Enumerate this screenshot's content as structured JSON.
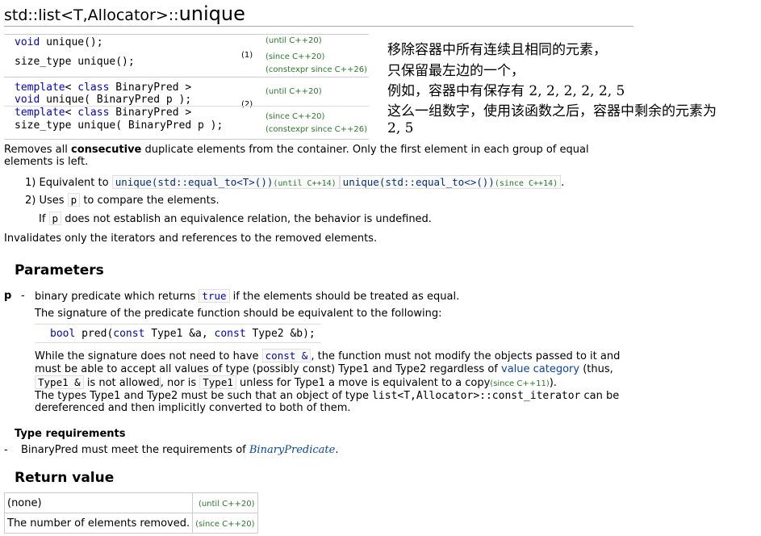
{
  "title": {
    "prefix": "std::list<T,Allocator>::",
    "name": "unique"
  },
  "declarations": [
    {
      "num": "(1)",
      "lines": [
        {
          "parts": [
            {
              "t": "void",
              "c": "kw"
            },
            {
              "t": " unique();",
              "c": "cls"
            }
          ],
          "ver": "(until C++20)"
        },
        {
          "parts": [
            {
              "t": "size_type unique();",
              "c": "cls"
            }
          ],
          "ver": "(since C++20)"
        },
        {
          "parts": [],
          "ver": "(constexpr since C++26)"
        }
      ]
    },
    {
      "num": "(2)",
      "lines": [
        {
          "parts": [
            {
              "t": "template",
              "c": "kw"
            },
            {
              "t": "< ",
              "c": "cls"
            },
            {
              "t": "class",
              "c": "kw"
            },
            {
              "t": " BinaryPred >",
              "c": "cls"
            }
          ],
          "ver": "(until C++20)"
        },
        {
          "parts": [
            {
              "t": "void",
              "c": "kw"
            },
            {
              "t": " unique( BinaryPred p );",
              "c": "cls"
            }
          ],
          "ver": ""
        },
        {
          "parts": [
            {
              "t": "template",
              "c": "kw"
            },
            {
              "t": "< ",
              "c": "cls"
            },
            {
              "t": "class",
              "c": "kw"
            },
            {
              "t": " BinaryPred >",
              "c": "cls"
            }
          ],
          "ver": "(since C++20)"
        },
        {
          "parts": [
            {
              "t": "size_type unique( BinaryPred p );",
              "c": "cls"
            }
          ],
          "ver": "(constexpr since C++26)"
        }
      ]
    }
  ],
  "annotation_cn": [
    "移除容器中所有连续且相同的元素，",
    "只保留最左边的一个，",
    "例如，容器中有保存有 2, 2, 2, 2, 2, 5",
    "这么一组数字，使用该函数之后，容器中剩余的元素为",
    "2, 5"
  ],
  "desc": {
    "removes_a": "Removes all ",
    "removes_b": "consecutive",
    "removes_c": " duplicate elements from the container. Only the first element in each group of equal elements is left.",
    "item1_a": "1) Equivalent to ",
    "item1_code1": "unique(std::equal_to<T>())",
    "item1_ver1": "(until C++14)",
    "item1_code2": "unique(std::equal_to<>())",
    "item1_ver2": "(since C++14)",
    "item2_a": "2) Uses ",
    "item2_code": "p",
    "item2_b": " to compare the elements.",
    "item2_c_a": "If ",
    "item2_c_code": "p",
    "item2_c_b": " does not establish an equivalence relation, the behavior is undefined.",
    "invalidates": "Invalidates only the iterators and references to the removed elements."
  },
  "parameters": {
    "heading": "Parameters",
    "name": "p",
    "dash": "-",
    "desc_a": "binary predicate which returns ",
    "desc_code": "true",
    "desc_b": " if the elements should be treated as equal.",
    "sig_intro": "The signature of the predicate function should be equivalent to the following:",
    "sig_code": "bool pred(const Type1 &a, const Type2 &b);",
    "while_a": "While the signature does not need to have ",
    "while_code1": "const &",
    "while_b": ", the function must not modify the objects passed to it and must be able to accept all values of type (possibly const) Type1 and Type2 regardless of ",
    "while_link": "value category",
    "while_c": " (thus, ",
    "while_code2": "Type1 &",
    "while_d": " is not allowed",
    "while_e": ", nor is ",
    "while_code3": "Type1",
    "while_f": " unless for Type1 a move is equivalent to a copy",
    "while_ver": "(since C++11)",
    "while_g": ").",
    "types_a": "The types Type1 and Type2 must be such that an object of type ",
    "types_code": "list<T,Allocator>::const_iterator",
    "types_b": " can be dereferenced and then implicitly converted to both of them."
  },
  "type_req": {
    "heading": "Type requirements",
    "dash": "-",
    "a": "BinaryPred must meet the requirements of ",
    "link": "BinaryPredicate",
    "b": "."
  },
  "return_value": {
    "heading": "Return value",
    "rows": [
      {
        "text": "(none)",
        "ver": "(until C++20)"
      },
      {
        "text": "The number of elements removed.",
        "ver": "(since C++20)"
      }
    ]
  }
}
